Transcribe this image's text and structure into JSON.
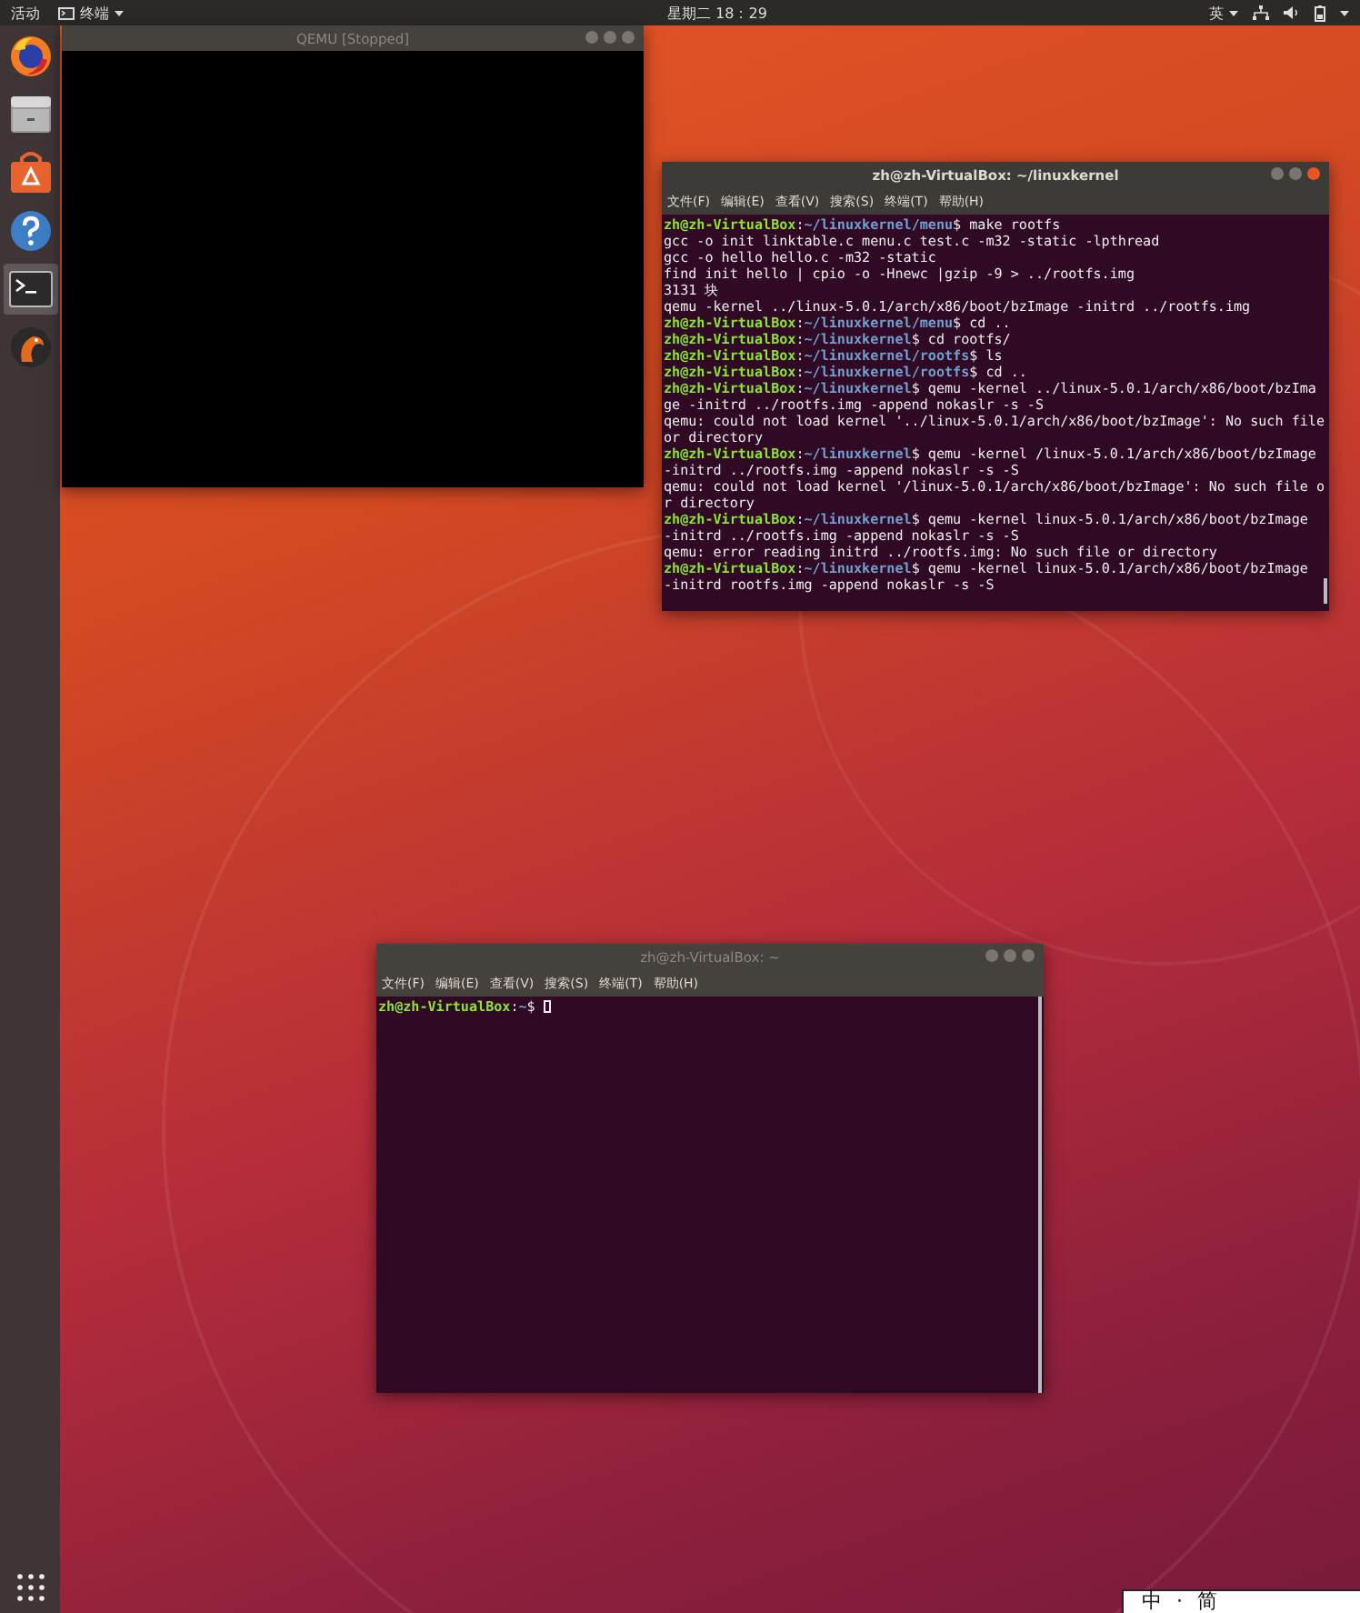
{
  "top_bar": {
    "activities": "活动",
    "app_menu": "终端",
    "clock": "星期二 18：29",
    "input_method": "英"
  },
  "dock": {
    "items": [
      {
        "kind": "firefox",
        "selected": false
      },
      {
        "kind": "files",
        "selected": false
      },
      {
        "kind": "software",
        "selected": false
      },
      {
        "kind": "help",
        "selected": false
      },
      {
        "kind": "terminal",
        "selected": true
      },
      {
        "kind": "qemu",
        "selected": false
      }
    ]
  },
  "qemu_window": {
    "title": "QEMU [Stopped]"
  },
  "terminal_windows": [
    {
      "title": "zh@zh-VirtualBox: ~/linuxkernel",
      "menu": [
        "文件(F)",
        "编辑(E)",
        "查看(V)",
        "搜索(S)",
        "终端(T)",
        "帮助(H)"
      ],
      "cursor": false,
      "lines": [
        {
          "kind": "prompt",
          "user": "zh@zh-VirtualBox",
          "sep": ":",
          "path": "~/linuxkernel/menu",
          "command": "$ make rootfs"
        },
        {
          "kind": "output",
          "text": "gcc -o init linktable.c menu.c test.c -m32 -static -lpthread"
        },
        {
          "kind": "output",
          "text": "gcc -o hello hello.c -m32 -static"
        },
        {
          "kind": "output",
          "text": "find init hello | cpio -o -Hnewc |gzip -9 > ../rootfs.img"
        },
        {
          "kind": "output",
          "text": "3131 块"
        },
        {
          "kind": "output",
          "text": "qemu -kernel ../linux-5.0.1/arch/x86/boot/bzImage -initrd ../rootfs.img"
        },
        {
          "kind": "prompt",
          "user": "zh@zh-VirtualBox",
          "sep": ":",
          "path": "~/linuxkernel/menu",
          "command": "$ cd .."
        },
        {
          "kind": "prompt",
          "user": "zh@zh-VirtualBox",
          "sep": ":",
          "path": "~/linuxkernel",
          "command": "$ cd rootfs/"
        },
        {
          "kind": "prompt",
          "user": "zh@zh-VirtualBox",
          "sep": ":",
          "path": "~/linuxkernel/rootfs",
          "command": "$ ls"
        },
        {
          "kind": "prompt",
          "user": "zh@zh-VirtualBox",
          "sep": ":",
          "path": "~/linuxkernel/rootfs",
          "command": "$ cd .."
        },
        {
          "kind": "prompt",
          "user": "zh@zh-VirtualBox",
          "sep": ":",
          "path": "~/linuxkernel",
          "command": "$ qemu -kernel ../linux-5.0.1/arch/x86/boot/bzImage -initrd ../rootfs.img -append nokaslr -s -S"
        },
        {
          "kind": "output",
          "text": "qemu: could not load kernel '../linux-5.0.1/arch/x86/boot/bzImage': No such file or directory"
        },
        {
          "kind": "prompt",
          "user": "zh@zh-VirtualBox",
          "sep": ":",
          "path": "~/linuxkernel",
          "command": "$ qemu -kernel /linux-5.0.1/arch/x86/boot/bzImage -initrd ../rootfs.img -append nokaslr -s -S"
        },
        {
          "kind": "output",
          "text": "qemu: could not load kernel '/linux-5.0.1/arch/x86/boot/bzImage': No such file or directory"
        },
        {
          "kind": "prompt",
          "user": "zh@zh-VirtualBox",
          "sep": ":",
          "path": "~/linuxkernel",
          "command": "$ qemu -kernel linux-5.0.1/arch/x86/boot/bzImage -initrd ../rootfs.img -append nokaslr -s -S"
        },
        {
          "kind": "output",
          "text": "qemu: error reading initrd ../rootfs.img: No such file or directory"
        },
        {
          "kind": "prompt",
          "user": "zh@zh-VirtualBox",
          "sep": ":",
          "path": "~/linuxkernel",
          "command": "$ qemu -kernel linux-5.0.1/arch/x86/boot/bzImage -initrd rootfs.img -append nokaslr -s -S"
        }
      ]
    },
    {
      "title": "zh@zh-VirtualBox: ~",
      "menu": [
        "文件(F)",
        "编辑(E)",
        "查看(V)",
        "搜索(S)",
        "终端(T)",
        "帮助(H)"
      ],
      "cursor": true,
      "lines": [
        {
          "kind": "prompt",
          "user": "zh@zh-VirtualBox",
          "sep": ":",
          "path": "~",
          "command": "$"
        }
      ]
    }
  ],
  "ime_bar": {
    "items": [
      "中",
      "·",
      "简"
    ]
  }
}
